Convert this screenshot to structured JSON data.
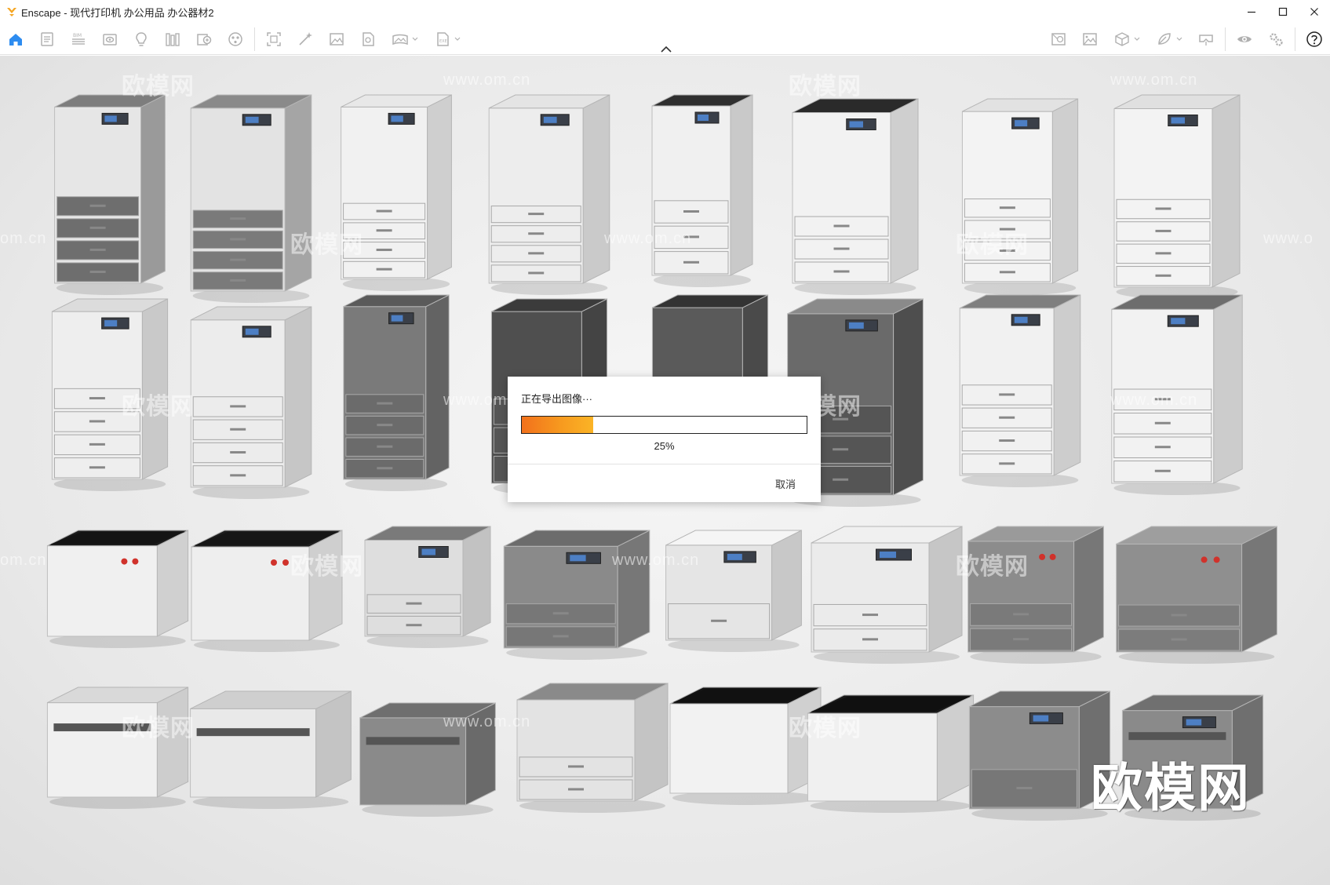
{
  "window": {
    "app_name": "Enscape",
    "title": "Enscape - 现代打印机  办公用品 办公器材2",
    "controls": [
      "minimize",
      "maximize",
      "close"
    ]
  },
  "toolbar": {
    "left_icons": [
      "home-icon",
      "notes-icon",
      "bim-icon",
      "view-icon",
      "light-icon",
      "library-icon",
      "asset-icon",
      "material-icon",
      "capture-icon",
      "magic-icon",
      "screenshot-icon",
      "batch-icon",
      "panorama-icon",
      "export-icon"
    ],
    "right_icons": [
      "atmosphere-icon",
      "image-settings-icon",
      "object-icon",
      "landscape-icon",
      "vr-icon",
      "visibility-icon",
      "settings-icon",
      "help-icon"
    ],
    "accent_color": "#2d8cf0"
  },
  "viewport": {
    "watermark_text": "欧模网",
    "watermark_url": "www.om.cn",
    "watermark_partial_left": "om.cn",
    "watermark_partial_right": "www.o"
  },
  "dialog": {
    "title": "正在导出图像···",
    "progress_fraction": 0.25,
    "progress_label": "25%",
    "cancel_label": "取消"
  }
}
